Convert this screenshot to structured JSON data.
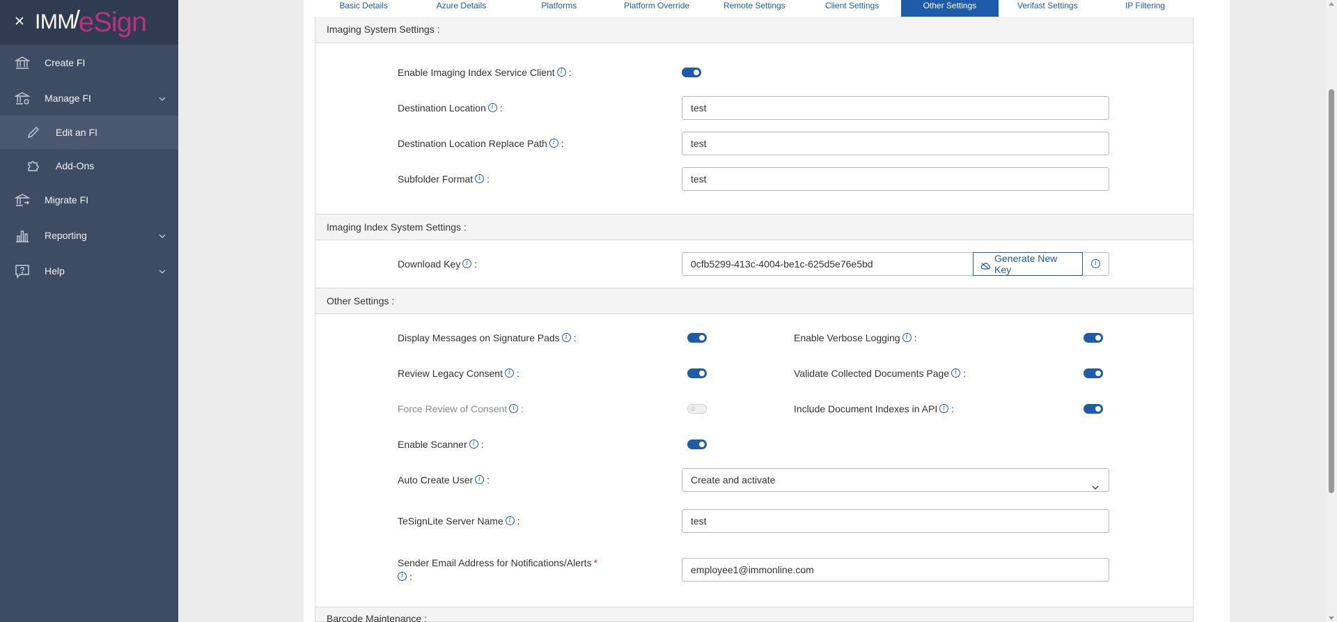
{
  "sidebar": {
    "logo_imm": "IMM",
    "logo_esign": "eSign",
    "items": [
      {
        "label": "Create FI"
      },
      {
        "label": "Manage FI"
      },
      {
        "label": "Edit an FI"
      },
      {
        "label": "Add-Ons"
      },
      {
        "label": "Migrate FI"
      },
      {
        "label": "Reporting"
      },
      {
        "label": "Help"
      }
    ]
  },
  "tabs": [
    "Basic Details",
    "Azure Details",
    "Platforms",
    "Platform Override",
    "Remote Settings",
    "Client Settings",
    "Other Settings",
    "Verifast Settings",
    "IP Filtering"
  ],
  "active_tab": "Other Settings",
  "imaging_system": {
    "heading": "Imaging System Settings :",
    "enable_label": "Enable Imaging Index Service Client",
    "enable_on": true,
    "dest_label": "Destination Location",
    "dest_value": "test",
    "replace_label": "Destination Location Replace Path",
    "replace_value": "test",
    "subfolder_label": "Subfolder Format",
    "subfolder_value": "test"
  },
  "imaging_index": {
    "heading": "Imaging Index System Settings :",
    "download_label": "Download Key",
    "download_value": "0cfb5299-413c-4004-be1c-625d5e76e5bd",
    "generate_label": "Generate New Key"
  },
  "other": {
    "heading": "Other Settings :",
    "display_msgs": {
      "label": "Display Messages on Signature Pads",
      "on": true
    },
    "verbose": {
      "label": "Enable Verbose Logging",
      "on": true
    },
    "review_legacy": {
      "label": "Review Legacy Consent",
      "on": true
    },
    "validate_docs": {
      "label": "Validate Collected Documents Page",
      "on": true
    },
    "force_review": {
      "label": "Force Review of Consent",
      "on": false
    },
    "include_idx": {
      "label": "Include Document Indexes in API",
      "on": true
    },
    "scanner": {
      "label": "Enable Scanner",
      "on": true
    },
    "auto_create_label": "Auto Create User",
    "auto_create_value": "Create and activate",
    "server_label": "TeSignLite Server Name",
    "server_value": "test",
    "sender_label": "Sender Email Address for Notifications/Alerts",
    "sender_required": "*",
    "sender_value": "employee1@immonline.com"
  },
  "barcode": {
    "heading": "Barcode Maintenance :"
  },
  "colors": {
    "accent": "#1e5ba8",
    "sidebar": "#3d4b63",
    "brand_pink": "#b9327e"
  }
}
